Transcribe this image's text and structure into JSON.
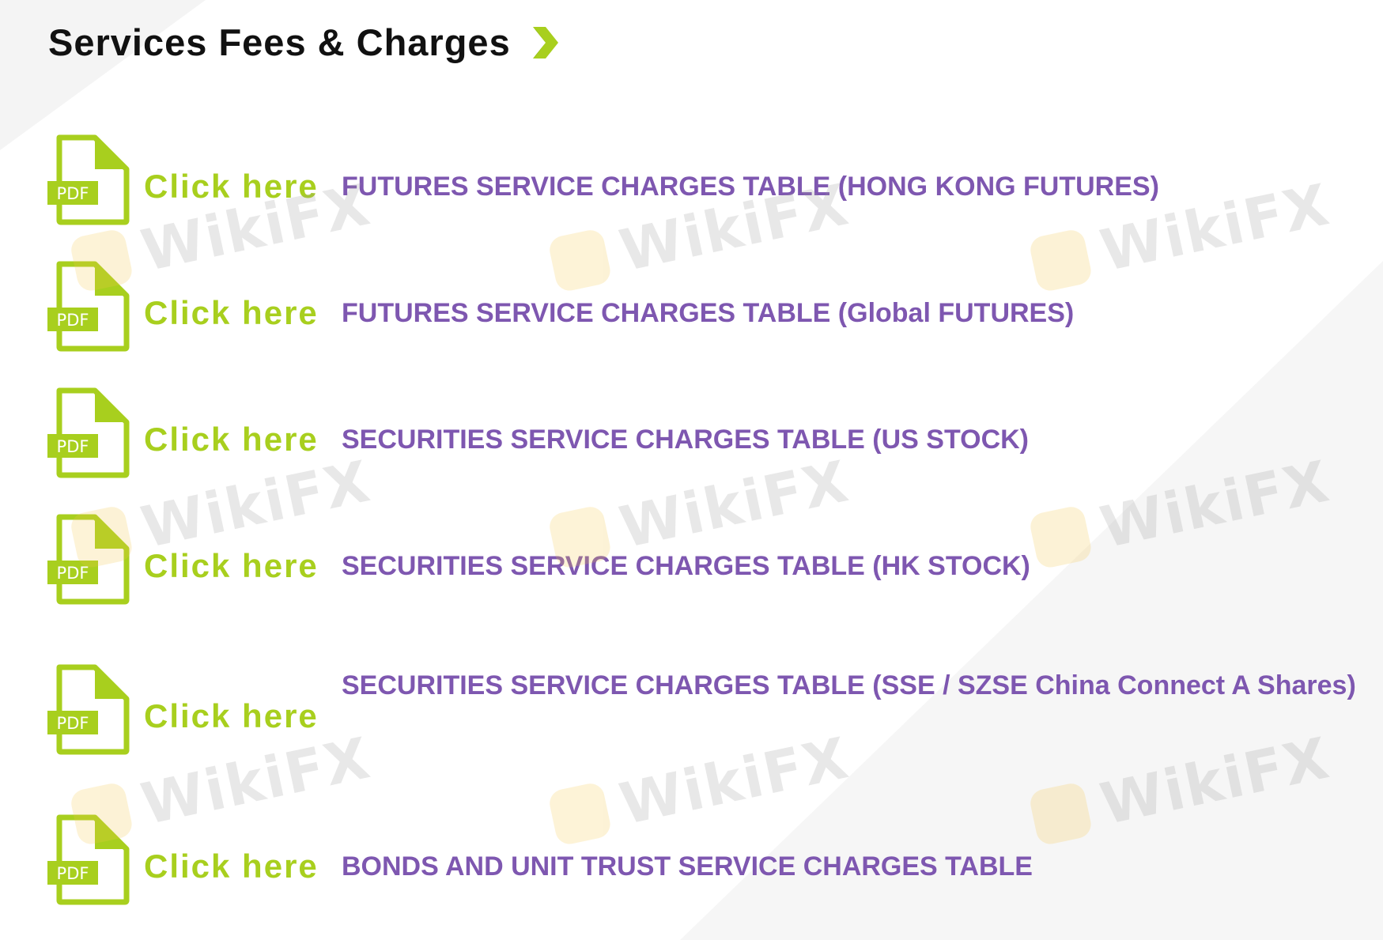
{
  "page": {
    "title": "Services Fees & Charges"
  },
  "accent_colors": {
    "title_text": "#111111",
    "click_here_green": "#a8cf1e",
    "link_purple": "#7e57b0",
    "chevron_green": "#a8cf1e"
  },
  "icons": {
    "pdf": "pdf-file-icon",
    "chevron": "chevron-right-icon"
  },
  "pdf_badge_text": "PDF",
  "watermark_text": "WikiFX",
  "items": [
    {
      "click_label": "Click here",
      "doc_title": "FUTURES SERVICE CHARGES TABLE (HONG KONG FUTURES)"
    },
    {
      "click_label": "Click here",
      "doc_title": "FUTURES SERVICE CHARGES TABLE (Global FUTURES)"
    },
    {
      "click_label": "Click here",
      "doc_title": "SECURITIES SERVICE CHARGES TABLE (US STOCK)"
    },
    {
      "click_label": "Click here",
      "doc_title": "SECURITIES SERVICE CHARGES TABLE (HK STOCK)"
    },
    {
      "click_label": "Click here",
      "doc_title": "SECURITIES SERVICE CHARGES TABLE (SSE / SZSE China Connect A Shares)"
    },
    {
      "click_label": "Click here",
      "doc_title": "BONDS AND UNIT TRUST SERVICE CHARGES TABLE"
    }
  ]
}
